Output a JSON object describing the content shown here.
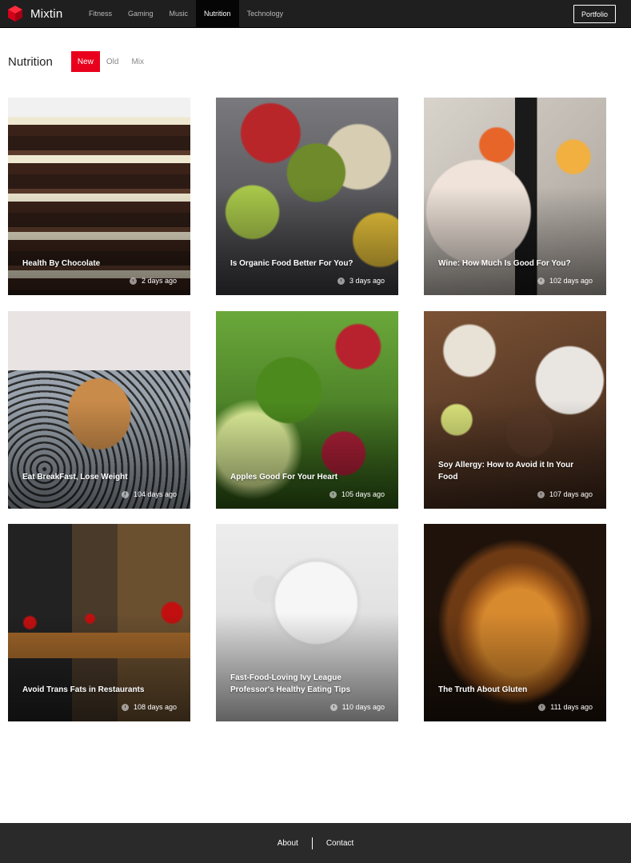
{
  "brand": {
    "name": "Mixtin",
    "icon": "cube-logo-icon",
    "accent": "#e8001d"
  },
  "nav": {
    "items": [
      {
        "label": "Fitness"
      },
      {
        "label": "Gaming"
      },
      {
        "label": "Music"
      },
      {
        "label": "Nutrition",
        "active": true
      },
      {
        "label": "Technology"
      }
    ],
    "portfolio_label": "Portfolio"
  },
  "section": {
    "title": "Nutrition",
    "filters": [
      {
        "label": "New",
        "active": true
      },
      {
        "label": "Old"
      },
      {
        "label": "Mix"
      }
    ]
  },
  "posts": [
    {
      "title": "Health By Chocolate",
      "time": "2 days ago",
      "image": "chocolate-stack"
    },
    {
      "title": "Is Organic Food Better For You?",
      "time": "3 days ago",
      "image": "organic-produce"
    },
    {
      "title": "Wine: How Much Is Good For You?",
      "time": "102 days ago",
      "image": "wine-table"
    },
    {
      "title": "Eat BreakFast, Lose Weight",
      "time": "104 days ago",
      "image": "muffin"
    },
    {
      "title": "Apples Good For Your Heart",
      "time": "105 days ago",
      "image": "apple-tree"
    },
    {
      "title": "Soy Allergy: How to Avoid it In Your Food",
      "time": "107 days ago",
      "image": "soy-dishes"
    },
    {
      "title": "Avoid Trans Fats in Restaurants",
      "time": "108 days ago",
      "image": "restaurant-interior"
    },
    {
      "title": "Fast-Food-Loving Ivy League Professor's Healthy Eating Tips",
      "time": "110 days ago",
      "image": "empty-plate"
    },
    {
      "title": "The Truth About Gluten",
      "time": "111 days ago",
      "image": "bread-loaf"
    }
  ],
  "footer": {
    "links": [
      {
        "label": "About"
      },
      {
        "label": "Contact"
      }
    ]
  }
}
